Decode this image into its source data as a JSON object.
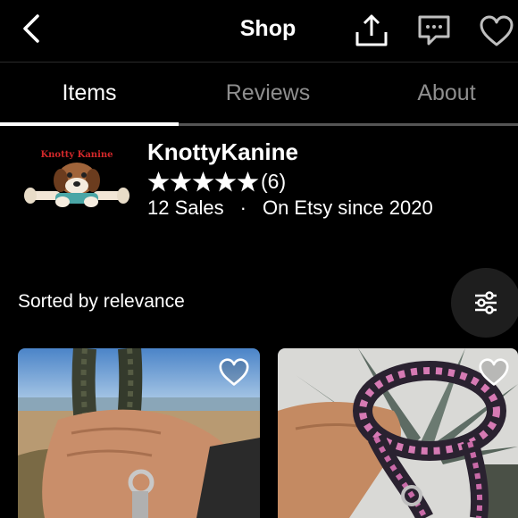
{
  "header": {
    "title": "Shop",
    "back_icon": "chevron-left-icon",
    "share_icon": "share-icon",
    "message_icon": "message-icon",
    "favorite_icon": "heart-outline-icon"
  },
  "tabs": [
    {
      "label": "Items",
      "active": true
    },
    {
      "label": "Reviews",
      "active": false
    },
    {
      "label": "About",
      "active": false
    }
  ],
  "shop": {
    "logo_text": "Knotty Kanine",
    "name": "KnottyKanine",
    "rating_stars": 5,
    "rating_count": "(6)",
    "sales": "12 Sales",
    "separator": "·",
    "since": "On Etsy since 2020"
  },
  "listing": {
    "sort_label": "Sorted by relevance",
    "filter_icon": "sliders-icon",
    "items": [
      {
        "image": "dark green braided paracord leash held in hand at beach",
        "favorite_icon": "heart-outline-icon"
      },
      {
        "image": "pink and black braided paracord leash held in hand near plant",
        "favorite_icon": "heart-outline-icon"
      }
    ]
  },
  "colors": {
    "background": "#000000",
    "text": "#ffffff",
    "inactive_tab": "#8e8e8e",
    "logo_red": "#d3282a"
  }
}
